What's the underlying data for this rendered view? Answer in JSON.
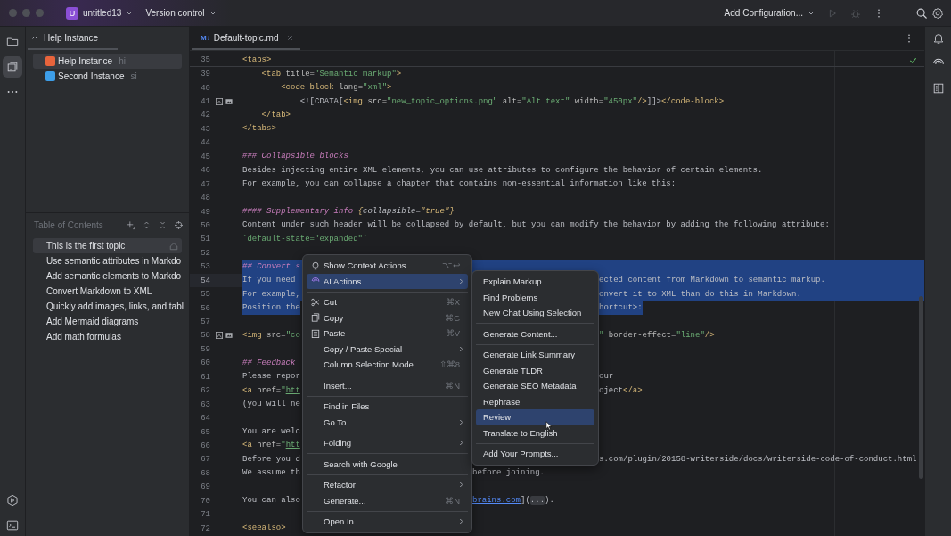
{
  "title_bar": {
    "project_badge": "U",
    "project": "untitled13",
    "vcs": "Version control",
    "run_config": "Add Configuration...",
    "run_disabled": true
  },
  "left_toolbar": [
    {
      "kind": "folder",
      "selected": false
    },
    {
      "kind": "window",
      "selected": true
    },
    {
      "kind": "more",
      "selected": false
    }
  ],
  "left_toolbar_bottom": [
    {
      "kind": "run",
      "selected": false
    },
    {
      "kind": "terminal",
      "selected": false
    }
  ],
  "instances_panel": {
    "title": "Help Instance",
    "items": [
      {
        "name": "Help Instance",
        "abbr": "hi",
        "color": "#e8643c",
        "selected": true
      },
      {
        "name": "Second Instance",
        "abbr": "si",
        "color": "#3d9ee8",
        "selected": false
      }
    ]
  },
  "toc": {
    "title": "Table of Contents",
    "items": [
      {
        "label": "This is the first topic",
        "selected": true,
        "start_page": true
      },
      {
        "label": "Use semantic attributes in Markdo",
        "selected": false,
        "start_page": false
      },
      {
        "label": "Add semantic elements to Markdo",
        "selected": false,
        "start_page": false
      },
      {
        "label": "Convert Markdown to XML",
        "selected": false,
        "start_page": false
      },
      {
        "label": "Quickly add images, links, and tabl",
        "selected": false,
        "start_page": false
      },
      {
        "label": "Add Mermaid diagrams",
        "selected": false,
        "start_page": false
      },
      {
        "label": "Add math formulas",
        "selected": false,
        "start_page": false
      }
    ]
  },
  "editor": {
    "tab": {
      "badge": "M↓",
      "name": "Default-topic.md"
    },
    "lines": [
      {
        "number": "35",
        "kind": "plain",
        "selected": false,
        "current": false,
        "markers": false,
        "left": [
          {
            "kind": "tag",
            "text": "<tabs>"
          }
        ]
      },
      {
        "number": "39",
        "kind": "plain",
        "selected": false,
        "current": false,
        "markers": false,
        "left": [
          {
            "kind": "tag",
            "text": "    <tab"
          },
          {
            "kind": "attr",
            "text": " title="
          },
          {
            "kind": "str",
            "text": "\"Semantic markup\""
          },
          {
            "kind": "tag",
            "text": ">"
          }
        ]
      },
      {
        "number": "40",
        "kind": "plain",
        "selected": false,
        "current": false,
        "markers": false,
        "left": [
          {
            "kind": "tag",
            "text": "        <code-block"
          },
          {
            "kind": "attr",
            "text": " lang="
          },
          {
            "kind": "str",
            "text": "\"xml\""
          },
          {
            "kind": "tag",
            "text": ">"
          }
        ]
      },
      {
        "number": "41",
        "kind": "plain",
        "selected": false,
        "current": false,
        "markers": true,
        "left": [
          {
            "kind": "text",
            "text": "            <![CDATA["
          },
          {
            "kind": "tag",
            "text": "<img"
          },
          {
            "kind": "attr",
            "text": " src="
          },
          {
            "kind": "str",
            "text": "\"new_topic_options.png\""
          },
          {
            "kind": "attr",
            "text": " alt="
          },
          {
            "kind": "str",
            "text": "\"Alt text\""
          },
          {
            "kind": "attr",
            "text": " width="
          },
          {
            "kind": "str",
            "text": "\"450px\""
          },
          {
            "kind": "tag",
            "text": "/>"
          },
          {
            "kind": "text",
            "text": "]]>"
          },
          {
            "kind": "tag",
            "text": "</code-block>"
          }
        ]
      },
      {
        "number": "42",
        "kind": "plain",
        "selected": false,
        "current": false,
        "markers": false,
        "left": [
          {
            "kind": "tag",
            "text": "    </tab>"
          }
        ]
      },
      {
        "number": "43",
        "kind": "plain",
        "selected": false,
        "current": false,
        "markers": false,
        "left": [
          {
            "kind": "tag",
            "text": "</tabs>"
          }
        ]
      },
      {
        "number": "44",
        "selected": false,
        "current": false,
        "markers": false
      },
      {
        "number": "45",
        "kind": "plain",
        "selected": false,
        "current": false,
        "markers": false,
        "left": [
          {
            "kind": "heading",
            "text": "### Collapsible blocks"
          }
        ]
      },
      {
        "number": "46",
        "kind": "plain",
        "selected": false,
        "current": false,
        "markers": false,
        "left": [
          {
            "kind": "text",
            "text": "Besides injecting entire XML elements, you can use attributes to configure the behavior of certain elements."
          }
        ]
      },
      {
        "number": "47",
        "kind": "plain",
        "selected": false,
        "current": false,
        "markers": false,
        "left": [
          {
            "kind": "text",
            "text": "For example, you can collapse a chapter that contains non-essential information like this:"
          }
        ]
      },
      {
        "number": "48",
        "selected": false,
        "current": false,
        "markers": false
      },
      {
        "number": "49",
        "kind": "plain",
        "selected": false,
        "current": false,
        "markers": false,
        "left": [
          {
            "kind": "heading",
            "text": "#### Supplementary info "
          },
          {
            "kind": "brace",
            "text": "{"
          },
          {
            "kind": "attr_i",
            "text": "collapsible="
          },
          {
            "kind": "str_i",
            "text": "\"true\""
          },
          {
            "kind": "brace",
            "text": "}"
          }
        ]
      },
      {
        "number": "50",
        "kind": "plain",
        "selected": false,
        "current": false,
        "markers": false,
        "left": [
          {
            "kind": "text",
            "text": "Content under such header will be collapsed by default, but you can modify the behavior by adding the following attribute:"
          }
        ]
      },
      {
        "number": "51",
        "kind": "plain",
        "selected": false,
        "current": false,
        "markers": false,
        "left": [
          {
            "kind": "code",
            "text": "`default-state=\"expanded\"`"
          }
        ]
      },
      {
        "number": "52",
        "selected": false,
        "current": false,
        "markers": false
      },
      {
        "number": "53",
        "kind": "undermenu",
        "selected": true,
        "current": false,
        "markers": false,
        "left": [
          {
            "kind": "heading",
            "text": "## Convert s"
          }
        ]
      },
      {
        "number": "54",
        "kind": "undersubmenu",
        "selected": true,
        "current": true,
        "markers": false,
        "left": [
          {
            "kind": "text",
            "text": "If you need"
          }
        ],
        "right": [
          {
            "kind": "text",
            "text": "ected content from Markdown to semantic markup."
          }
        ]
      },
      {
        "number": "55",
        "kind": "undersubmenu",
        "selected": true,
        "current": false,
        "markers": false,
        "left": [
          {
            "kind": "text",
            "text": "For example,"
          }
        ],
        "right": [
          {
            "kind": "text",
            "text": "onvert it to XML than do this in Markdown."
          }
        ]
      },
      {
        "number": "56",
        "kind": "undersubmenu",
        "selected": true,
        "current": false,
        "markers": false,
        "left": [
          {
            "kind": "text",
            "text": "Position the"
          }
        ],
        "right": [
          {
            "kind": "text",
            "text": "hortcut>:"
          }
        ]
      },
      {
        "number": "57",
        "selected": false,
        "current": false,
        "markers": false
      },
      {
        "number": "58",
        "kind": "undersubmenu",
        "selected": false,
        "current": false,
        "markers": true,
        "left": [
          {
            "kind": "tag",
            "text": "<img"
          },
          {
            "kind": "attr",
            "text": " src="
          },
          {
            "kind": "str",
            "text": "\"co"
          }
        ],
        "right": [
          {
            "kind": "str",
            "text": "\""
          },
          {
            "kind": "attr",
            "text": " border-effect="
          },
          {
            "kind": "str",
            "text": "\"line\""
          },
          {
            "kind": "tag",
            "text": "/>"
          }
        ]
      },
      {
        "number": "59",
        "selected": false,
        "current": false,
        "markers": false
      },
      {
        "number": "60",
        "kind": "undermenu",
        "selected": false,
        "current": false,
        "markers": false,
        "left": [
          {
            "kind": "heading",
            "text": "## Feedback"
          }
        ]
      },
      {
        "number": "61",
        "kind": "undersubmenu",
        "selected": false,
        "current": false,
        "markers": false,
        "left": [
          {
            "kind": "text",
            "text": "Please repor"
          }
        ],
        "right": [
          {
            "kind": "text",
            "text": "our"
          }
        ]
      },
      {
        "number": "62",
        "kind": "undersubmenu",
        "selected": false,
        "current": false,
        "markers": false,
        "left": [
          {
            "kind": "tag",
            "text": "<a"
          },
          {
            "kind": "attr",
            "text": " href="
          },
          {
            "kind": "str",
            "text": "\""
          },
          {
            "kind": "url",
            "text": "htt"
          }
        ],
        "right": [
          {
            "kind": "text",
            "text": "oject"
          },
          {
            "kind": "tag",
            "text": "</a>"
          }
        ]
      },
      {
        "number": "63",
        "kind": "undermenu",
        "selected": false,
        "current": false,
        "markers": false,
        "left": [
          {
            "kind": "text",
            "text": "(you will ne"
          }
        ]
      },
      {
        "number": "64",
        "selected": false,
        "current": false,
        "markers": false
      },
      {
        "number": "65",
        "kind": "undermenu",
        "selected": false,
        "current": false,
        "markers": false,
        "left": [
          {
            "kind": "text",
            "text": "You are welc"
          }
        ]
      },
      {
        "number": "66",
        "kind": "undermenu",
        "selected": false,
        "current": false,
        "markers": false,
        "left": [
          {
            "kind": "tag",
            "text": "<a"
          },
          {
            "kind": "attr",
            "text": " href="
          },
          {
            "kind": "str",
            "text": "\""
          },
          {
            "kind": "url",
            "text": "htt"
          }
        ]
      },
      {
        "number": "67",
        "kind": "undersubmenu",
        "selected": false,
        "current": false,
        "markers": false,
        "left": [
          {
            "kind": "text",
            "text": "Before you d"
          }
        ],
        "right": [
          {
            "kind": "text",
            "text": "s.com/plugin/20158-writerside/docs/writerside-code-of-conduct.html"
          }
        ]
      },
      {
        "number": "68",
        "kind": "undermenu",
        "selected": false,
        "current": false,
        "markers": false,
        "left": [
          {
            "kind": "text",
            "text": "We assume th"
          }
        ],
        "right": [
          {
            "kind": "text",
            "text": "before joining."
          }
        ]
      },
      {
        "number": "69",
        "selected": false,
        "current": false,
        "markers": false
      },
      {
        "number": "70",
        "kind": "undermenu",
        "selected": false,
        "current": false,
        "markers": false,
        "left": [
          {
            "kind": "text",
            "text": "You can also"
          }
        ],
        "right": [
          {
            "kind": "link",
            "text": "brains.com"
          },
          {
            "kind": "text",
            "text": "]("
          },
          {
            "kind": "fold",
            "text": "..."
          },
          {
            "kind": "text",
            "text": ")."
          }
        ]
      },
      {
        "number": "71",
        "selected": false,
        "current": false,
        "markers": false
      },
      {
        "number": "72",
        "kind": "plain",
        "selected": false,
        "current": false,
        "markers": false,
        "left": [
          {
            "kind": "tag",
            "text": "<seealso>"
          }
        ]
      }
    ]
  },
  "context_menu": {
    "items": [
      {
        "kind": "bulb",
        "label": "Show Context Actions",
        "shortcut": "⌥↩",
        "submenu": false,
        "selected": false,
        "separator_before": false
      },
      {
        "kind": "ai",
        "label": "AI Actions",
        "submenu": true,
        "selected": true,
        "separator_before": false
      },
      {
        "kind": "cut",
        "label": "Cut",
        "shortcut": "⌘X",
        "submenu": false,
        "selected": false,
        "separator_before": true
      },
      {
        "kind": "copy",
        "label": "Copy",
        "shortcut": "⌘C",
        "submenu": false,
        "selected": false,
        "separator_before": false
      },
      {
        "kind": "paste",
        "label": "Paste",
        "shortcut": "⌘V",
        "submenu": false,
        "selected": false,
        "separator_before": false
      },
      {
        "kind": "plain",
        "label": "Copy / Paste Special",
        "submenu": true,
        "selected": false,
        "separator_before": false
      },
      {
        "kind": "plain",
        "label": "Column Selection Mode",
        "shortcut": "⇧⌘8",
        "submenu": false,
        "selected": false,
        "separator_before": false
      },
      {
        "kind": "plain",
        "label": "Insert...",
        "shortcut": "⌘N",
        "submenu": false,
        "selected": false,
        "separator_before": true
      },
      {
        "kind": "plain",
        "label": "Find in Files",
        "submenu": false,
        "selected": false,
        "separator_before": true
      },
      {
        "kind": "plain",
        "label": "Go To",
        "submenu": true,
        "selected": false,
        "separator_before": false
      },
      {
        "kind": "plain",
        "label": "Folding",
        "submenu": true,
        "selected": false,
        "separator_before": true
      },
      {
        "kind": "plain",
        "label": "Search with Google",
        "submenu": false,
        "selected": false,
        "separator_before": true
      },
      {
        "kind": "plain",
        "label": "Refactor",
        "submenu": true,
        "selected": false,
        "separator_before": true
      },
      {
        "kind": "plain",
        "label": "Generate...",
        "shortcut": "⌘N",
        "submenu": false,
        "selected": false,
        "separator_before": false
      },
      {
        "kind": "plain",
        "label": "Open In",
        "submenu": true,
        "selected": false,
        "separator_before": true
      }
    ]
  },
  "ai_submenu": {
    "items": [
      {
        "label": "Explain Markup",
        "selected": false,
        "separator_before": false
      },
      {
        "label": "Find Problems",
        "selected": false,
        "separator_before": false
      },
      {
        "label": "New Chat Using Selection",
        "selected": false,
        "separator_before": false
      },
      {
        "label": "Generate Content...",
        "selected": false,
        "separator_before": true
      },
      {
        "label": "Generate Link Summary",
        "selected": false,
        "separator_before": true
      },
      {
        "label": "Generate TLDR",
        "selected": false,
        "separator_before": false
      },
      {
        "label": "Generate SEO Metadata",
        "selected": false,
        "separator_before": false
      },
      {
        "label": "Rephrase",
        "selected": false,
        "separator_before": false
      },
      {
        "label": "Review",
        "selected": true,
        "separator_before": false
      },
      {
        "label": "Translate to English",
        "selected": false,
        "separator_before": false
      },
      {
        "label": "Add Your Prompts...",
        "selected": false,
        "separator_before": true
      }
    ]
  }
}
